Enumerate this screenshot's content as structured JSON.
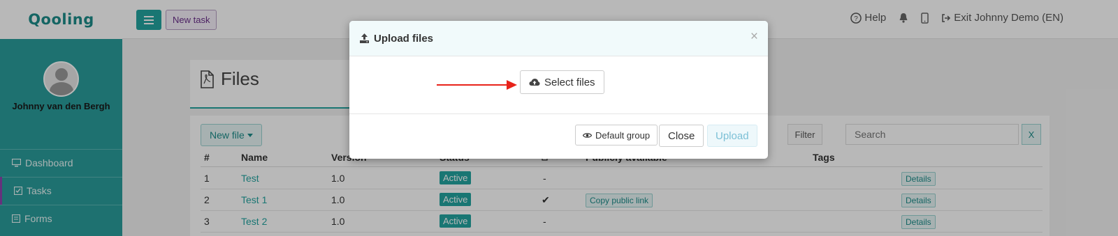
{
  "app": {
    "logo": "Qooling",
    "new_task_label": "New task",
    "help_label": "Help",
    "exit_label": "Exit Johnny Demo (EN)"
  },
  "sidebar": {
    "user_name": "Johnny van den Bergh",
    "items": [
      {
        "label": "Dashboard",
        "icon": "monitor-icon"
      },
      {
        "label": "Tasks",
        "icon": "checkbox-icon"
      },
      {
        "label": "Forms",
        "icon": "form-icon"
      }
    ]
  },
  "page": {
    "title": "Files",
    "new_file_label": "New file",
    "filter_label": "Filter",
    "search_placeholder": "Search",
    "clear_label": "X"
  },
  "table": {
    "headers": [
      "#",
      "Name",
      "Version",
      "Status",
      "Publicly available",
      "Tags"
    ],
    "rows": [
      {
        "num": "1",
        "name": "Test",
        "version": "1.0",
        "status": "Active",
        "public": "-",
        "copy": "",
        "details": "Details"
      },
      {
        "num": "2",
        "name": "Test 1",
        "version": "1.0",
        "status": "Active",
        "public": "✔",
        "copy": "Copy public link",
        "details": "Details"
      },
      {
        "num": "3",
        "name": "Test 2",
        "version": "1.0",
        "status": "Active",
        "public": "-",
        "copy": "",
        "details": "Details"
      }
    ]
  },
  "modal": {
    "title": "Upload files",
    "close_symbol": "×",
    "select_files_label": "Select files",
    "default_group_label": "Default group",
    "close_label": "Close",
    "upload_label": "Upload"
  },
  "colors": {
    "brand": "#23a4a0",
    "arrow": "#e8231a",
    "accent_purple": "#8e44ad"
  }
}
